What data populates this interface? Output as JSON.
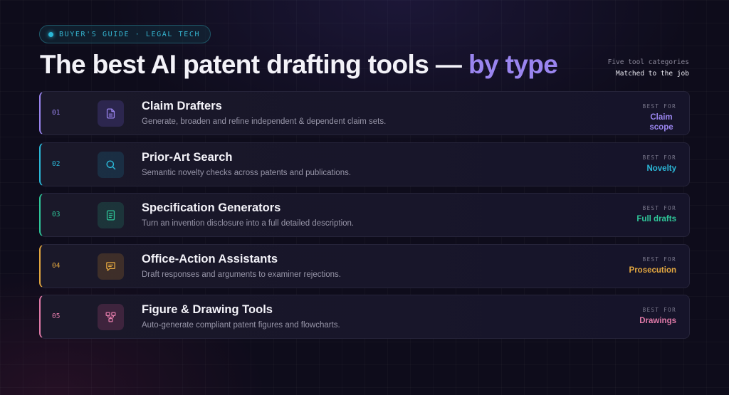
{
  "header": {
    "eyebrow": "BUYER'S GUIDE · LEGAL TECH",
    "title_main": "The best AI patent drafting tools — ",
    "title_accent": "by type",
    "side_note_line1": "Five tool categories",
    "side_note_line2": "Matched to the job"
  },
  "best_for_label": "BEST FOR",
  "colors": {
    "background": "#0e0c1b",
    "accent_purple": "#9a85ef",
    "accent_cyan": "#2bb8d8",
    "accent_green": "#2fc79a",
    "accent_amber": "#e3a740",
    "accent_pink": "#e07aa8"
  },
  "categories": [
    {
      "num": "01",
      "icon": "document-icon",
      "name": "Claim Drafters",
      "desc": "Generate, broaden and refine independent & dependent claim sets.",
      "best_for": "Claim scope",
      "color": "#9a85ef"
    },
    {
      "num": "02",
      "icon": "search-icon",
      "name": "Prior-Art Search",
      "desc": "Semantic novelty checks across patents and publications.",
      "best_for": "Novelty",
      "color": "#2bb8d8"
    },
    {
      "num": "03",
      "icon": "page-lines-icon",
      "name": "Specification Generators",
      "desc": "Turn an invention disclosure into a full detailed description.",
      "best_for": "Full drafts",
      "color": "#2fc79a"
    },
    {
      "num": "04",
      "icon": "message-icon",
      "name": "Office-Action Assistants",
      "desc": "Draft responses and arguments to examiner rejections.",
      "best_for": "Prosecution",
      "color": "#e3a740"
    },
    {
      "num": "05",
      "icon": "flowchart-icon",
      "name": "Figure & Drawing Tools",
      "desc": "Auto-generate compliant patent figures and flowcharts.",
      "best_for": "Drawings",
      "color": "#e07aa8"
    }
  ]
}
